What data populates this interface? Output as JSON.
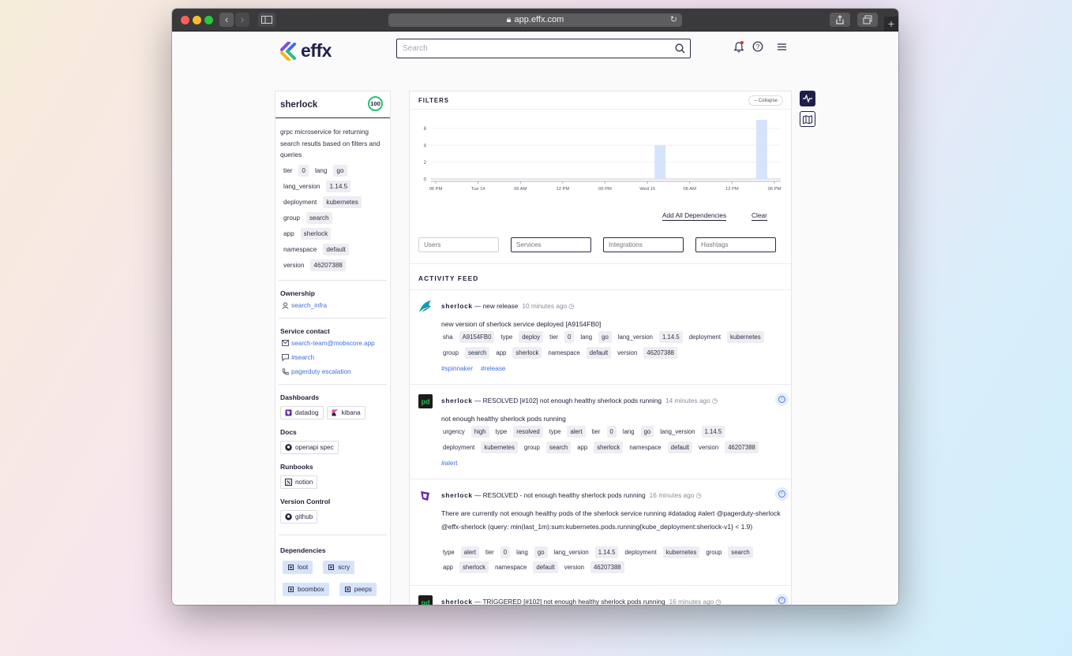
{
  "browser": {
    "url": "app.effx.com"
  },
  "header": {
    "logo_text": "effx",
    "search_placeholder": "Search"
  },
  "service": {
    "name": "sherlock",
    "score": "100",
    "description": "grpc microservice for returning search results based on filters and queries",
    "attributes": [
      [
        {
          "k": "tier",
          "v": "0"
        },
        {
          "k": "lang",
          "v": "go"
        }
      ],
      [
        {
          "k": "lang_version",
          "v": "1.14.5"
        }
      ],
      [
        {
          "k": "deployment",
          "v": "kubernetes"
        }
      ],
      [
        {
          "k": "group",
          "v": "search"
        }
      ],
      [
        {
          "k": "app",
          "v": "sherlock"
        }
      ],
      [
        {
          "k": "namespace",
          "v": "default"
        }
      ],
      [
        {
          "k": "version",
          "v": "46207388"
        }
      ]
    ],
    "ownership_title": "Ownership",
    "owner": "search_infra",
    "contact_title": "Service contact",
    "contact_email": "search-team@mobscore.app",
    "contact_slack": "#search",
    "contact_pager": "pagerduty escalation",
    "dashboards_title": "Dashboards",
    "dashboards": [
      "datadog",
      "kibana"
    ],
    "docs_title": "Docs",
    "docs": [
      "openapi spec"
    ],
    "runbooks_title": "Runbooks",
    "runbooks": [
      "notion"
    ],
    "vc_title": "Version Control",
    "vc": [
      "github"
    ],
    "deps_title": "Dependencies",
    "dependencies": [
      "loot",
      "scry",
      "boombox",
      "peeps"
    ]
  },
  "filters": {
    "title": "FILTERS",
    "collapse": "– Collapse",
    "add_all": "Add All Dependencies",
    "clear": "Clear",
    "inputs": [
      {
        "placeholder": "Users",
        "disabled": true
      },
      {
        "placeholder": "Services",
        "disabled": false
      },
      {
        "placeholder": "Integrations",
        "disabled": false
      },
      {
        "placeholder": "Hashtags",
        "disabled": false
      }
    ]
  },
  "chart_data": {
    "type": "bar",
    "categories": [
      "06 PM",
      "Tue 14",
      "06 AM",
      "12 PM",
      "06 PM",
      "Wed 15",
      "06 AM",
      "12 PM",
      "06 PM"
    ],
    "yticks": [
      0,
      2,
      4,
      6
    ],
    "ylim": [
      0,
      7
    ],
    "bars": [
      {
        "x": 5.3,
        "value": 4
      },
      {
        "x": 7.7,
        "value": 7
      }
    ],
    "bar_color": "#d6e4fb"
  },
  "feed": {
    "title": "ACTIVITY FEED",
    "items": [
      {
        "icon": "spinnaker-icon",
        "service": "sherlock",
        "title": " — new release",
        "time": "10 minutes ago",
        "body": "new version of sherlock service deployed [A9154FB0]",
        "tags": [
          [
            [
              "sha",
              "A9154FB0"
            ],
            [
              "type",
              "deploy"
            ],
            [
              "tier",
              "0"
            ],
            [
              "lang",
              "go"
            ],
            [
              "lang_version",
              "1.14.5"
            ],
            [
              "deployment",
              "kubernetes"
            ]
          ],
          [
            [
              "group",
              "search"
            ],
            [
              "app",
              "sherlock"
            ],
            [
              "namespace",
              "default"
            ],
            [
              "version",
              "46207388"
            ]
          ]
        ],
        "hashtags": [
          "#spinnaker",
          "#release"
        ]
      },
      {
        "icon": "pagerduty-icon",
        "service": "sherlock",
        "title": " — RESOLVED [#102] not enough healthy sherlock pods running",
        "time": "14 minutes ago",
        "body": "not enough healthy sherlock pods running",
        "tags": [
          [
            [
              "urgency",
              "high"
            ],
            [
              "type",
              "resolved"
            ],
            [
              "type",
              "alert"
            ],
            [
              "tier",
              "0"
            ],
            [
              "lang",
              "go"
            ],
            [
              "lang_version",
              "1.14.5"
            ]
          ],
          [
            [
              "deployment",
              "kubernetes"
            ],
            [
              "group",
              "search"
            ],
            [
              "app",
              "sherlock"
            ],
            [
              "namespace",
              "default"
            ],
            [
              "version",
              "46207388"
            ]
          ]
        ],
        "hashtags": [
          "#alert"
        ]
      },
      {
        "icon": "datadog-icon",
        "service": "sherlock",
        "title": " — RESOLVED - not enough healthy sherlock pods running",
        "time": "16 minutes ago",
        "body": "There are currently not enough healthy pods of the sherlock service running #datadog #alert @pagerduty-sherlock @effx-sherlock (query: min(last_1m):sum:kubernetes.pods.running{kube_deployment:sherlock-v1} < 1.9)",
        "tags": [
          [
            [
              "type",
              "alert"
            ],
            [
              "tier",
              "0"
            ],
            [
              "lang",
              "go"
            ],
            [
              "lang_version",
              "1.14.5"
            ],
            [
              "deployment",
              "kubernetes"
            ],
            [
              "group",
              "search"
            ]
          ],
          [
            [
              "app",
              "sherlock"
            ],
            [
              "namespace",
              "default"
            ],
            [
              "version",
              "46207388"
            ]
          ]
        ],
        "hashtags": []
      },
      {
        "icon": "pagerduty-icon",
        "service": "sherlock",
        "title": " — TRIGGERED [#102] not enough healthy sherlock pods running",
        "time": "16 minutes ago",
        "body": "",
        "tags": [],
        "hashtags": []
      }
    ]
  }
}
